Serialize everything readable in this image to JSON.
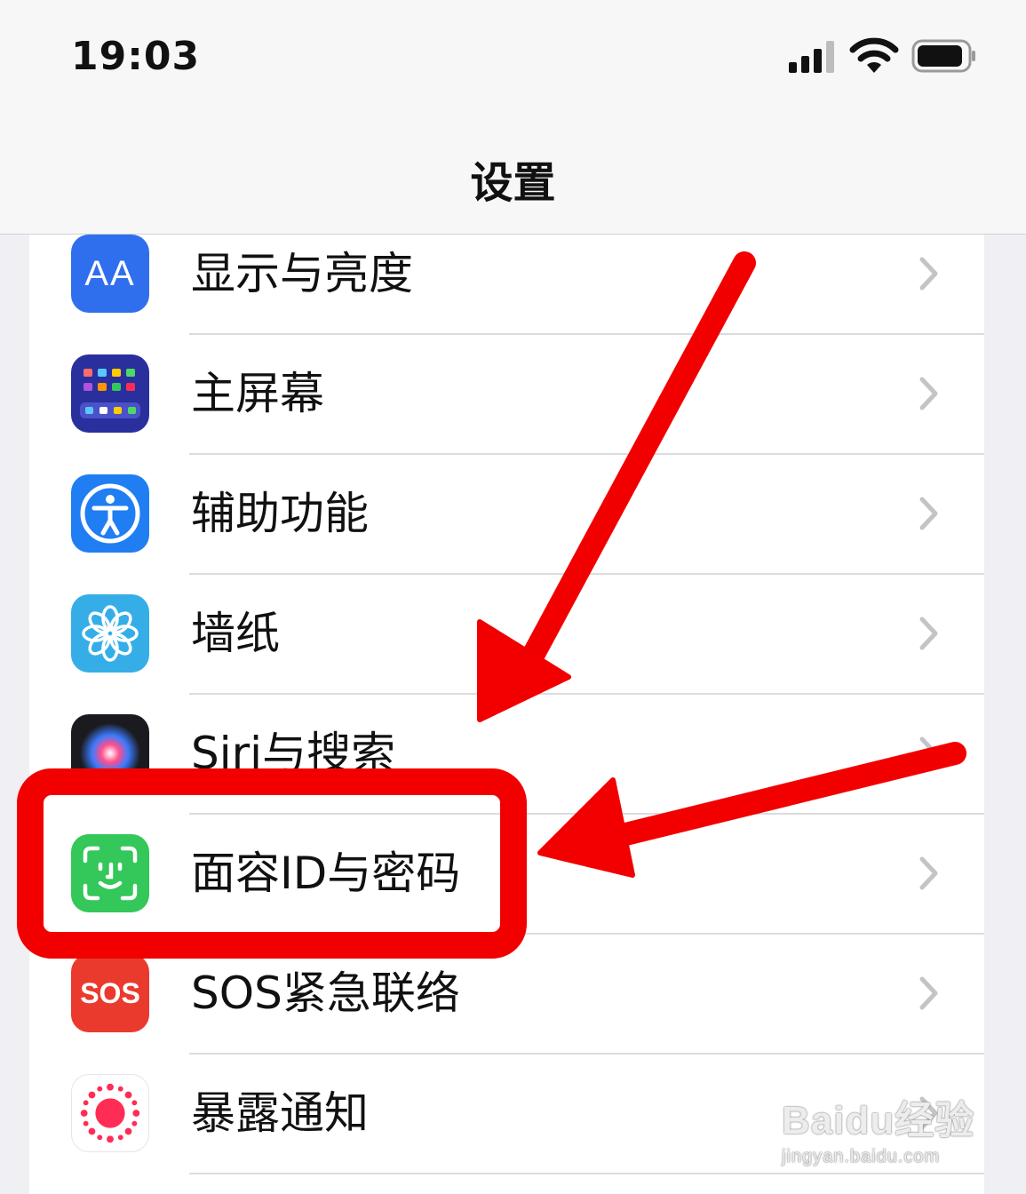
{
  "status": {
    "time": "19:03"
  },
  "nav": {
    "title": "设置"
  },
  "settings": {
    "items": [
      {
        "label": "显示与亮度",
        "icon": "display-brightness-icon",
        "icon_text": "AA",
        "color": "#2f6fee"
      },
      {
        "label": "主屏幕",
        "icon": "home-screen-icon",
        "color": "#2a2f9e"
      },
      {
        "label": "辅助功能",
        "icon": "accessibility-icon",
        "color": "#1f7ef2"
      },
      {
        "label": "墙纸",
        "icon": "wallpaper-icon",
        "color": "#35aee8"
      },
      {
        "label": "Siri与搜索",
        "icon": "siri-icon",
        "color": "#1b1b1f"
      },
      {
        "label": "面容ID与密码",
        "icon": "face-id-icon",
        "color": "#34c759"
      },
      {
        "label": "SOS紧急联络",
        "icon": "sos-icon",
        "icon_text": "SOS",
        "color": "#ea3a2e"
      },
      {
        "label": "暴露通知",
        "icon": "exposure-notification-icon",
        "color": "#ff2d55"
      }
    ]
  },
  "annotation": {
    "highlight_color": "#f20000"
  },
  "watermark": {
    "main": "Baidu经验",
    "url": "jingyan.baidu.com"
  }
}
